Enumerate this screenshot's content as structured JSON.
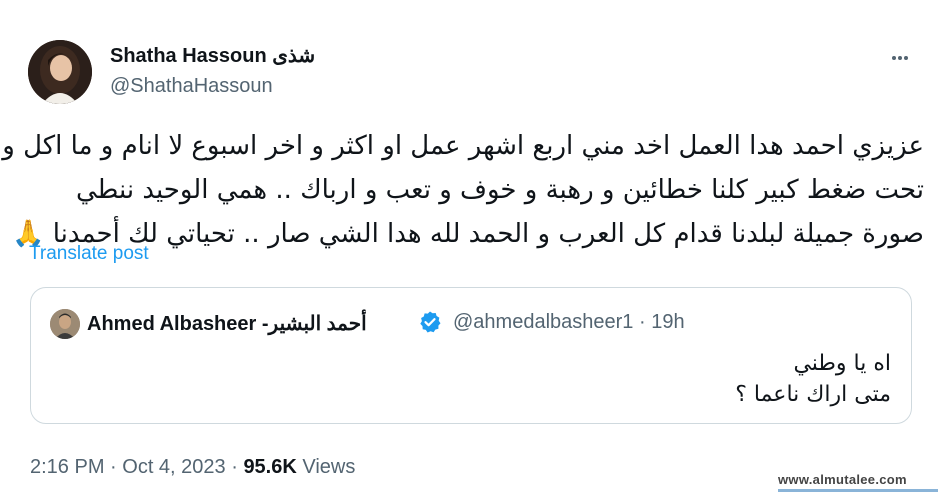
{
  "author": {
    "display_name": "Shatha Hassoun شذى",
    "handle": "@ShathaHassoun"
  },
  "post": {
    "lines": [
      "عزيزي احمد هدا العمل اخد مني اربع اشهر عمل او اكثر و اخر اسبوع لا انام و ما اكل و",
      "تحت ضغط كبير كلنا خطائين و رهبة و خوف و تعب و ارباك .. همي الوحيد ننطي",
      "صورة جميلة لبلدنا قدام كل العرب و الحمد لله هدا الشي صار .. تحياتي لك أحمدنا 🙏"
    ],
    "translate_label": "Translate post"
  },
  "quote": {
    "name": "Ahmed Albasheer -أحمد البشير",
    "meta": "@ahmedalbasheer1 · 19h",
    "lines": [
      "اه يا وطني",
      "متى اراك ناعما ؟"
    ]
  },
  "footer": {
    "time_date": "2:16 PM · Oct 4, 2023 · ",
    "views_count": "95.6K",
    "views_label": " Views"
  },
  "icons": {
    "more": "more-icon",
    "verified": "verified-badge-icon",
    "verified_color": "#1d9bf0",
    "link_color": "#1d9bf0"
  },
  "watermark": "www.almutalee.com"
}
